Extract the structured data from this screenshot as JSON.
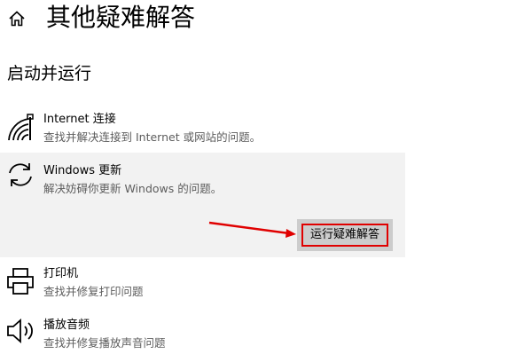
{
  "header": {
    "title": "其他疑难解答",
    "home_icon": "home-icon"
  },
  "section": {
    "title": "启动并运行"
  },
  "items": [
    {
      "title": "Internet 连接",
      "desc": "查找并解决连接到 Internet 或网站的问题。",
      "icon": "wifi-icon"
    },
    {
      "title": "Windows 更新",
      "desc": "解决妨碍你更新 Windows 的问题。",
      "icon": "sync-icon",
      "expanded": true
    },
    {
      "title": "打印机",
      "desc": "查找并修复打印问题",
      "icon": "printer-icon"
    },
    {
      "title": "播放音频",
      "desc": "查找并修复播放声音问题",
      "icon": "speaker-icon"
    }
  ],
  "run_button": {
    "label": "运行疑难解答"
  },
  "colors": {
    "highlight": "#e00000",
    "expanded_bg": "#f2f2f2",
    "button_bg": "#cccccc"
  }
}
